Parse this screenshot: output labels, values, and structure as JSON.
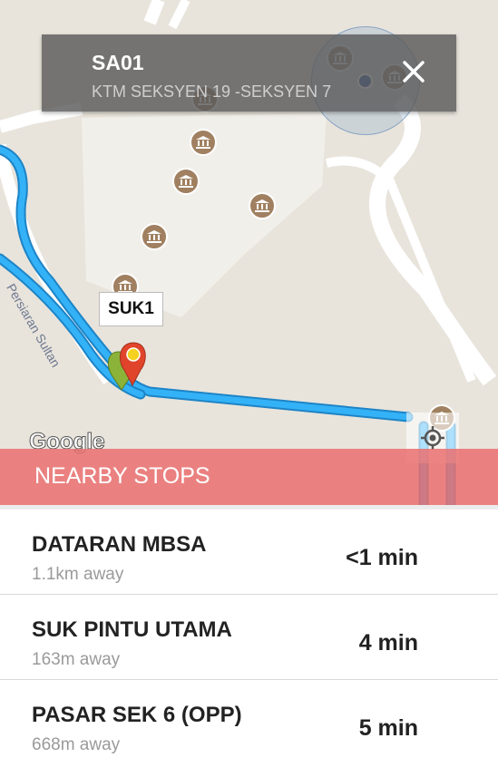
{
  "map": {
    "street_label": "Persiaran Sultan",
    "marker_label": "SUK1",
    "attribution": "Google",
    "icons": [
      "museum-icon",
      "location-pin-icon",
      "my-location-icon",
      "close-icon"
    ]
  },
  "info_card": {
    "title": "SA01",
    "subtitle": "KTM SEKSYEN 19 -SEKSYEN 7"
  },
  "nearby": {
    "header": "NEARBY STOPS",
    "stops": [
      {
        "name": "DATARAN MBSA",
        "distance": "1.1km away",
        "eta": "<1 min"
      },
      {
        "name": "SUK PINTU UTAMA",
        "distance": "163m away",
        "eta": "4 min"
      },
      {
        "name": "PASAR SEK 6 (OPP)",
        "distance": "668m away",
        "eta": "5 min"
      }
    ]
  },
  "colors": {
    "route": "#2aa8f2",
    "header_bar": "#ea7070",
    "poi": "#a08060",
    "location_dot": "#2f55a4"
  }
}
